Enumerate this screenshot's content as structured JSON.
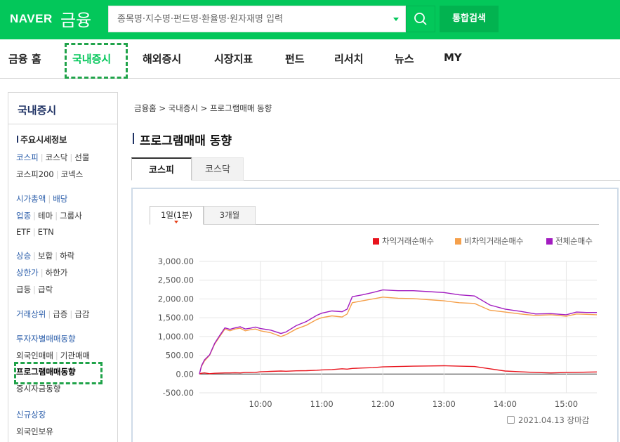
{
  "header": {
    "logo": "NAVER",
    "service": "금융",
    "search_placeholder": "종목명·지수명·펀드명·환율명·원자재명 입력",
    "integrated_search": "통합검색"
  },
  "nav": [
    {
      "label": "금융 홈",
      "active": false
    },
    {
      "label": "국내증시",
      "active": true
    },
    {
      "label": "해외증시",
      "active": false
    },
    {
      "label": "시장지표",
      "active": false
    },
    {
      "label": "펀드",
      "active": false
    },
    {
      "label": "리서치",
      "active": false
    },
    {
      "label": "뉴스",
      "active": false
    },
    {
      "label": "MY",
      "active": false
    }
  ],
  "sidebar": {
    "title": "국내증시",
    "section": "주요시세정보",
    "rows": [
      {
        "items": [
          {
            "t": "코스피",
            "blue": true
          },
          {
            "t": "코스닥"
          },
          {
            "t": "선물"
          }
        ]
      },
      {
        "items": [
          {
            "t": "코스피200"
          },
          {
            "t": "코넥스"
          }
        ]
      },
      {
        "items": [
          {
            "t": "시가총액",
            "blue": true
          },
          {
            "t": "배당",
            "blue": true
          }
        ]
      },
      {
        "items": [
          {
            "t": "업종",
            "blue": true
          },
          {
            "t": "테마"
          },
          {
            "t": "그룹사"
          }
        ]
      },
      {
        "items": [
          {
            "t": "ETF"
          },
          {
            "t": "ETN"
          }
        ]
      },
      {
        "items": [
          {
            "t": "상승",
            "blue": true
          },
          {
            "t": "보합"
          },
          {
            "t": "하락"
          }
        ]
      },
      {
        "items": [
          {
            "t": "상한가",
            "blue": true
          },
          {
            "t": "하한가"
          }
        ]
      },
      {
        "items": [
          {
            "t": "급등"
          },
          {
            "t": "급락"
          }
        ]
      },
      {
        "items": [
          {
            "t": "거래상위",
            "blue": true
          },
          {
            "t": "급증"
          },
          {
            "t": "급감"
          }
        ]
      },
      {
        "items": [
          {
            "t": "투자자별매매동향",
            "blue": true
          }
        ]
      },
      {
        "items": [
          {
            "t": "외국인매매"
          },
          {
            "t": "기관매매"
          }
        ]
      },
      {
        "items": [
          {
            "t": "프로그램매매동향",
            "bold": true
          }
        ]
      },
      {
        "items": [
          {
            "t": "증시자금동향"
          }
        ]
      },
      {
        "items": [
          {
            "t": "신규상장",
            "blue": true
          }
        ]
      },
      {
        "items": [
          {
            "t": "외국인보유"
          }
        ]
      }
    ]
  },
  "main": {
    "breadcrumb": "금융홈 > 국내증시 > 프로그램매매 동향",
    "title": "프로그램매매 동향",
    "tabs": [
      "코스피",
      "코스닥"
    ],
    "period_tabs": [
      "1일(1분)",
      "3개월"
    ],
    "timestamp": "2021.04.13 장마감"
  },
  "colors": {
    "brand": "#03c75a",
    "arbitrage": "#e8141d",
    "non_arbitrage": "#f5a04b",
    "total": "#a21cc0"
  },
  "chart_data": {
    "type": "line",
    "x": [
      "09:00",
      "09:02",
      "09:05",
      "09:10",
      "09:15",
      "09:20",
      "09:25",
      "09:30",
      "09:35",
      "09:40",
      "09:45",
      "09:50",
      "09:55",
      "10:00",
      "10:10",
      "10:20",
      "10:25",
      "10:35",
      "10:45",
      "10:55",
      "11:00",
      "11:10",
      "11:20",
      "11:25",
      "11:30",
      "11:40",
      "11:50",
      "12:00",
      "12:15",
      "12:30",
      "12:45",
      "13:00",
      "13:15",
      "13:30",
      "13:45",
      "14:00",
      "14:15",
      "14:30",
      "14:45",
      "15:00",
      "15:10",
      "15:20",
      "15:30"
    ],
    "series": [
      {
        "name": "차익거래순매수",
        "values": [
          0,
          20,
          30,
          10,
          20,
          25,
          30,
          30,
          35,
          30,
          40,
          40,
          45,
          60,
          70,
          80,
          75,
          85,
          90,
          100,
          110,
          120,
          140,
          130,
          150,
          160,
          170,
          190,
          200,
          210,
          215,
          220,
          210,
          200,
          140,
          80,
          60,
          40,
          30,
          40,
          45,
          50,
          55
        ]
      },
      {
        "name": "비차익거래순매수",
        "values": [
          0,
          200,
          350,
          500,
          800,
          1000,
          1200,
          1150,
          1200,
          1220,
          1150,
          1180,
          1200,
          1150,
          1100,
          1000,
          1050,
          1200,
          1300,
          1450,
          1500,
          1550,
          1520,
          1600,
          1900,
          1950,
          2000,
          2050,
          2020,
          2010,
          1980,
          1950,
          1900,
          1880,
          1700,
          1650,
          1600,
          1560,
          1580,
          1540,
          1600,
          1590,
          1580
        ]
      },
      {
        "name": "전체순매수",
        "values": [
          0,
          220,
          380,
          510,
          820,
          1030,
          1230,
          1190,
          1230,
          1260,
          1200,
          1220,
          1250,
          1210,
          1170,
          1080,
          1120,
          1290,
          1400,
          1560,
          1620,
          1680,
          1660,
          1730,
          2060,
          2110,
          2170,
          2240,
          2220,
          2220,
          2195,
          2170,
          2110,
          2080,
          1840,
          1730,
          1670,
          1600,
          1610,
          1580,
          1650,
          1640,
          1640
        ]
      }
    ],
    "ylim": [
      -500,
      3000
    ],
    "yticks": [
      "3,000.00",
      "2,500.00",
      "2,000.00",
      "1,500.00",
      "1,000.00",
      "500.00",
      "0.00",
      "-500.00"
    ],
    "xticks": [
      "10:00",
      "11:00",
      "12:00",
      "13:00",
      "14:00",
      "15:00"
    ],
    "grid": true,
    "legend": "top-right"
  }
}
